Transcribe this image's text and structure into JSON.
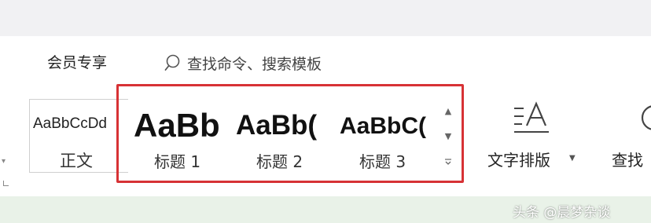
{
  "toolbar": {
    "member_tab": "会员专享",
    "search_placeholder": "查找命令、搜索模板"
  },
  "styles": {
    "normal": {
      "sample": "AaBbCcDd",
      "label": "正文"
    },
    "heading1": {
      "sample": "AaBb",
      "label": "标题 1"
    },
    "heading2": {
      "sample": "AaBb(",
      "label": "标题 2"
    },
    "heading3": {
      "sample": "AaBbC(",
      "label": "标题 3"
    }
  },
  "ribbon": {
    "text_layout_label": "文字排版",
    "find_label": "查找"
  },
  "watermark": "头条 @晨梦杂谈",
  "colors": {
    "highlight_border": "#d73235",
    "bottom_bar": "#e9f2e8",
    "top_bar": "#f1f1f3"
  },
  "icons": {
    "search": "search-icon",
    "text_layout": "text-layout-icon",
    "find": "find-icon",
    "scroll_up": "chevron-up-icon",
    "scroll_down": "chevron-down-icon",
    "expand": "gallery-expand-icon"
  }
}
